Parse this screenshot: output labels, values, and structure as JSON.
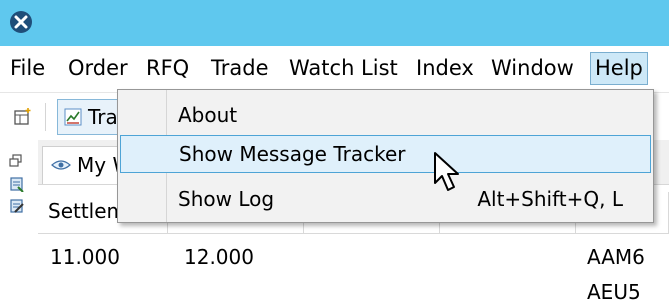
{
  "menubar": {
    "items": [
      {
        "label": "File"
      },
      {
        "label": "Order"
      },
      {
        "label": "RFQ"
      },
      {
        "label": "Trade"
      },
      {
        "label": "Watch List"
      },
      {
        "label": "Index"
      },
      {
        "label": "Window"
      },
      {
        "label": "Help"
      }
    ],
    "active": "Help"
  },
  "toolbar": {
    "trade_button_label": "Trade"
  },
  "tab": {
    "label": "My Watch List"
  },
  "grid": {
    "headers": [
      "Settlement",
      "",
      "",
      "",
      ""
    ],
    "rows": [
      [
        "11.000",
        "12.000",
        "",
        "",
        "AAM6"
      ],
      [
        "",
        "",
        "",
        "",
        "AEU5"
      ]
    ]
  },
  "help_menu": {
    "items": [
      {
        "label": "About",
        "shortcut": ""
      },
      {
        "label": "Show Message Tracker",
        "shortcut": ""
      },
      {
        "label": "Show Log",
        "shortcut": "Alt+Shift+Q, L"
      }
    ],
    "highlighted": "Show Message Tracker"
  },
  "colors": {
    "titlebar": "#5fc8ee",
    "menu_highlight": "#dff0fb",
    "menu_highlight_border": "#4ea4d6",
    "active_menu": "#cde8f7"
  },
  "icons": [
    "app-close-icon",
    "new-window-icon",
    "trade-chart-icon",
    "eye-icon",
    "restore-icon",
    "pin-icon",
    "edit-icon",
    "mouse-pointer-icon"
  ]
}
